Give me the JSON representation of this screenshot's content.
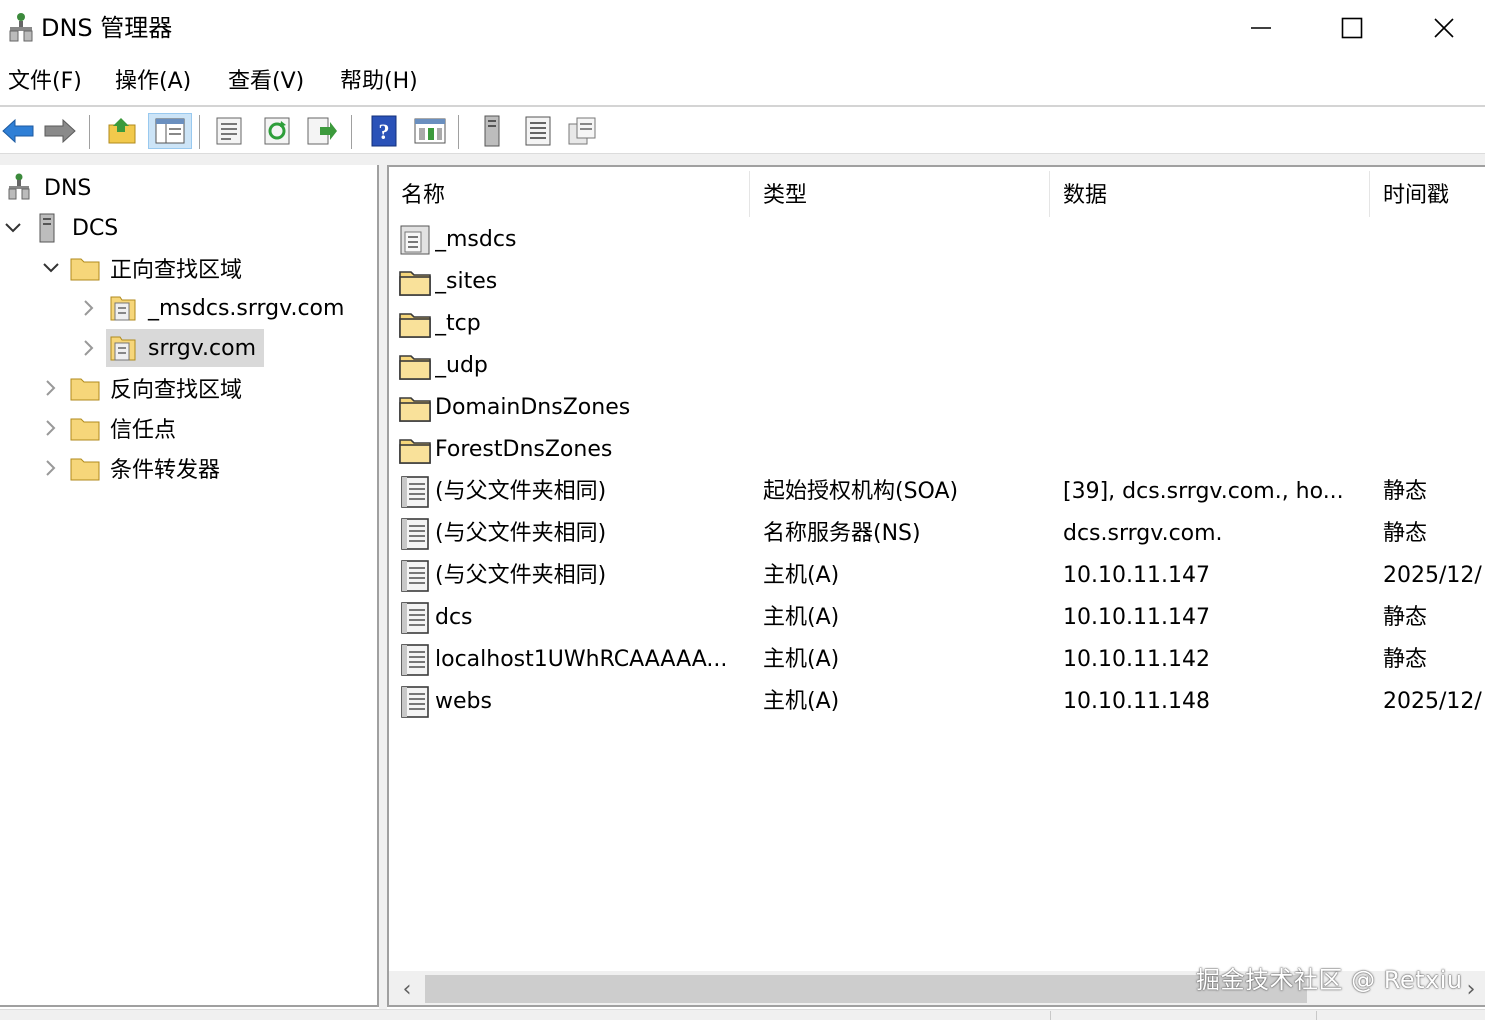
{
  "window": {
    "title": "DNS 管理器",
    "controls": [
      "minimize",
      "maximize",
      "close"
    ]
  },
  "menu": [
    "文件(F)",
    "操作(A)",
    "查看(V)",
    "帮助(H)"
  ],
  "toolbar": {
    "buttons": [
      "back-icon",
      "forward-icon",
      "up-folder-icon",
      "show-tree-icon",
      "properties-icon",
      "refresh-icon",
      "export-icon",
      "help-icon",
      "console-icon",
      "server-icon",
      "list-icon",
      "copy-icon"
    ]
  },
  "tree": {
    "root": "DNS",
    "server": "DCS",
    "forward_zones": "正向查找区域",
    "zone_msdcs": "_msdcs.srrgv.com",
    "zone_main": "srrgv.com",
    "reverse_zones": "反向查找区域",
    "trust_points": "信任点",
    "conditional_forwarders": "条件转发器"
  },
  "list": {
    "columns": [
      "名称",
      "类型",
      "数据",
      "时间戳"
    ],
    "rows": [
      {
        "icon": "zone-icon",
        "name": "_msdcs",
        "type": "",
        "data": "",
        "timestamp": ""
      },
      {
        "icon": "folder-icon",
        "name": "_sites",
        "type": "",
        "data": "",
        "timestamp": ""
      },
      {
        "icon": "folder-icon",
        "name": "_tcp",
        "type": "",
        "data": "",
        "timestamp": ""
      },
      {
        "icon": "folder-icon",
        "name": "_udp",
        "type": "",
        "data": "",
        "timestamp": ""
      },
      {
        "icon": "folder-icon",
        "name": "DomainDnsZones",
        "type": "",
        "data": "",
        "timestamp": ""
      },
      {
        "icon": "folder-icon",
        "name": "ForestDnsZones",
        "type": "",
        "data": "",
        "timestamp": ""
      },
      {
        "icon": "record-icon",
        "name": "(与父文件夹相同)",
        "type": "起始授权机构(SOA)",
        "data": "[39], dcs.srrgv.com., ho...",
        "timestamp": "静态"
      },
      {
        "icon": "record-icon",
        "name": "(与父文件夹相同)",
        "type": "名称服务器(NS)",
        "data": "dcs.srrgv.com.",
        "timestamp": "静态"
      },
      {
        "icon": "record-icon",
        "name": "(与父文件夹相同)",
        "type": "主机(A)",
        "data": "10.10.11.147",
        "timestamp": "2025/12/"
      },
      {
        "icon": "record-icon",
        "name": "dcs",
        "type": "主机(A)",
        "data": "10.10.11.147",
        "timestamp": "静态"
      },
      {
        "icon": "record-icon",
        "name": "localhost1UWhRCAAAAA...",
        "type": "主机(A)",
        "data": "10.10.11.142",
        "timestamp": "静态"
      },
      {
        "icon": "record-icon",
        "name": "webs",
        "type": "主机(A)",
        "data": "10.10.11.148",
        "timestamp": "2025/12/"
      }
    ]
  },
  "watermark": "掘金技术社区 @ Retxiu"
}
